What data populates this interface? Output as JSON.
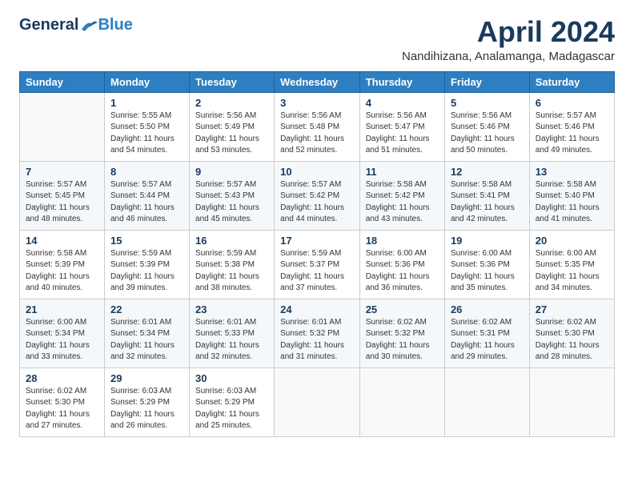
{
  "header": {
    "logo_general": "General",
    "logo_blue": "Blue",
    "month_title": "April 2024",
    "location": "Nandihizana, Analamanga, Madagascar"
  },
  "calendar": {
    "days_of_week": [
      "Sunday",
      "Monday",
      "Tuesday",
      "Wednesday",
      "Thursday",
      "Friday",
      "Saturday"
    ],
    "weeks": [
      [
        {
          "day": "",
          "info": ""
        },
        {
          "day": "1",
          "info": "Sunrise: 5:55 AM\nSunset: 5:50 PM\nDaylight: 11 hours\nand 54 minutes."
        },
        {
          "day": "2",
          "info": "Sunrise: 5:56 AM\nSunset: 5:49 PM\nDaylight: 11 hours\nand 53 minutes."
        },
        {
          "day": "3",
          "info": "Sunrise: 5:56 AM\nSunset: 5:48 PM\nDaylight: 11 hours\nand 52 minutes."
        },
        {
          "day": "4",
          "info": "Sunrise: 5:56 AM\nSunset: 5:47 PM\nDaylight: 11 hours\nand 51 minutes."
        },
        {
          "day": "5",
          "info": "Sunrise: 5:56 AM\nSunset: 5:46 PM\nDaylight: 11 hours\nand 50 minutes."
        },
        {
          "day": "6",
          "info": "Sunrise: 5:57 AM\nSunset: 5:46 PM\nDaylight: 11 hours\nand 49 minutes."
        }
      ],
      [
        {
          "day": "7",
          "info": "Sunrise: 5:57 AM\nSunset: 5:45 PM\nDaylight: 11 hours\nand 48 minutes."
        },
        {
          "day": "8",
          "info": "Sunrise: 5:57 AM\nSunset: 5:44 PM\nDaylight: 11 hours\nand 46 minutes."
        },
        {
          "day": "9",
          "info": "Sunrise: 5:57 AM\nSunset: 5:43 PM\nDaylight: 11 hours\nand 45 minutes."
        },
        {
          "day": "10",
          "info": "Sunrise: 5:57 AM\nSunset: 5:42 PM\nDaylight: 11 hours\nand 44 minutes."
        },
        {
          "day": "11",
          "info": "Sunrise: 5:58 AM\nSunset: 5:42 PM\nDaylight: 11 hours\nand 43 minutes."
        },
        {
          "day": "12",
          "info": "Sunrise: 5:58 AM\nSunset: 5:41 PM\nDaylight: 11 hours\nand 42 minutes."
        },
        {
          "day": "13",
          "info": "Sunrise: 5:58 AM\nSunset: 5:40 PM\nDaylight: 11 hours\nand 41 minutes."
        }
      ],
      [
        {
          "day": "14",
          "info": "Sunrise: 5:58 AM\nSunset: 5:39 PM\nDaylight: 11 hours\nand 40 minutes."
        },
        {
          "day": "15",
          "info": "Sunrise: 5:59 AM\nSunset: 5:39 PM\nDaylight: 11 hours\nand 39 minutes."
        },
        {
          "day": "16",
          "info": "Sunrise: 5:59 AM\nSunset: 5:38 PM\nDaylight: 11 hours\nand 38 minutes."
        },
        {
          "day": "17",
          "info": "Sunrise: 5:59 AM\nSunset: 5:37 PM\nDaylight: 11 hours\nand 37 minutes."
        },
        {
          "day": "18",
          "info": "Sunrise: 6:00 AM\nSunset: 5:36 PM\nDaylight: 11 hours\nand 36 minutes."
        },
        {
          "day": "19",
          "info": "Sunrise: 6:00 AM\nSunset: 5:36 PM\nDaylight: 11 hours\nand 35 minutes."
        },
        {
          "day": "20",
          "info": "Sunrise: 6:00 AM\nSunset: 5:35 PM\nDaylight: 11 hours\nand 34 minutes."
        }
      ],
      [
        {
          "day": "21",
          "info": "Sunrise: 6:00 AM\nSunset: 5:34 PM\nDaylight: 11 hours\nand 33 minutes."
        },
        {
          "day": "22",
          "info": "Sunrise: 6:01 AM\nSunset: 5:34 PM\nDaylight: 11 hours\nand 32 minutes."
        },
        {
          "day": "23",
          "info": "Sunrise: 6:01 AM\nSunset: 5:33 PM\nDaylight: 11 hours\nand 32 minutes."
        },
        {
          "day": "24",
          "info": "Sunrise: 6:01 AM\nSunset: 5:32 PM\nDaylight: 11 hours\nand 31 minutes."
        },
        {
          "day": "25",
          "info": "Sunrise: 6:02 AM\nSunset: 5:32 PM\nDaylight: 11 hours\nand 30 minutes."
        },
        {
          "day": "26",
          "info": "Sunrise: 6:02 AM\nSunset: 5:31 PM\nDaylight: 11 hours\nand 29 minutes."
        },
        {
          "day": "27",
          "info": "Sunrise: 6:02 AM\nSunset: 5:30 PM\nDaylight: 11 hours\nand 28 minutes."
        }
      ],
      [
        {
          "day": "28",
          "info": "Sunrise: 6:02 AM\nSunset: 5:30 PM\nDaylight: 11 hours\nand 27 minutes."
        },
        {
          "day": "29",
          "info": "Sunrise: 6:03 AM\nSunset: 5:29 PM\nDaylight: 11 hours\nand 26 minutes."
        },
        {
          "day": "30",
          "info": "Sunrise: 6:03 AM\nSunset: 5:29 PM\nDaylight: 11 hours\nand 25 minutes."
        },
        {
          "day": "",
          "info": ""
        },
        {
          "day": "",
          "info": ""
        },
        {
          "day": "",
          "info": ""
        },
        {
          "day": "",
          "info": ""
        }
      ]
    ]
  }
}
